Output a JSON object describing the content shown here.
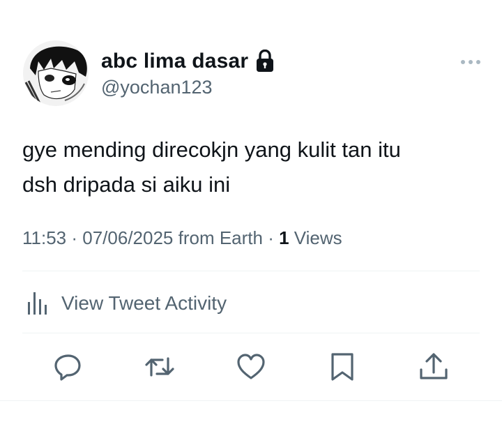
{
  "author": {
    "display_name": "abc lima dasar",
    "handle": "@yochan123",
    "protected": true,
    "avatar_icon": "anime-character-avatar"
  },
  "tweet": {
    "text_line1": "gye mending direcokjn yang kulit tan itu",
    "text_line2": "dsh dripada si aiku ini"
  },
  "meta": {
    "time": "11:53",
    "sep1": " · ",
    "date": "07/06/2025",
    "source": " from Earth",
    "sep2": " · ",
    "views_count": "1",
    "views_label": " Views"
  },
  "activity": {
    "label": "View Tweet Activity",
    "icon": "analytics-bars-icon"
  },
  "actions": {
    "reply_icon": "reply-icon",
    "retweet_icon": "retweet-icon",
    "like_icon": "heart-icon",
    "bookmark_icon": "bookmark-icon",
    "share_icon": "share-icon"
  },
  "colors": {
    "text": "#0f1419",
    "secondary": "#536471",
    "divider": "#eff3f4"
  }
}
